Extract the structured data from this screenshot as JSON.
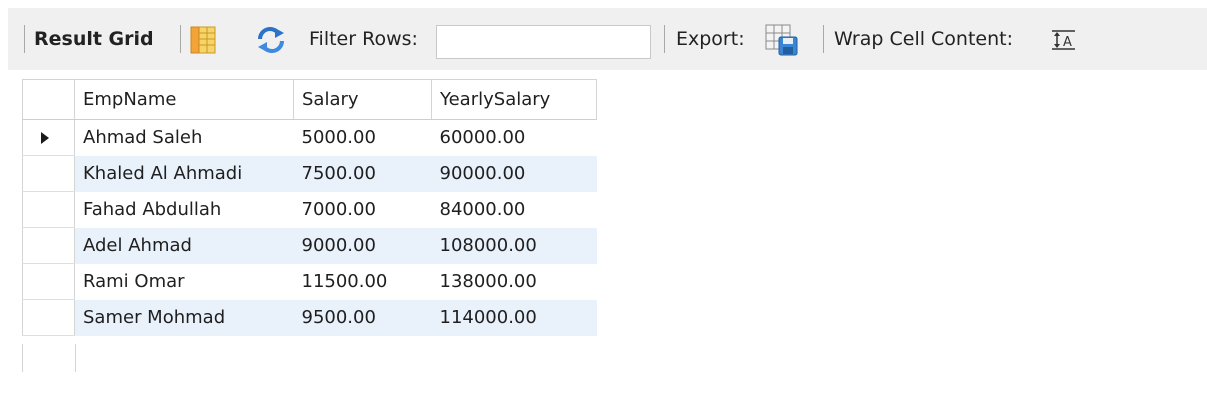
{
  "toolbar": {
    "result_grid_label": "Result Grid",
    "filter_rows_label": "Filter Rows:",
    "filter_value": "",
    "export_label": "Export:",
    "wrap_label": "Wrap Cell Content:",
    "icons": [
      "form-editor-icon",
      "refresh-icon",
      "export-icon",
      "wrap-cell-icon"
    ]
  },
  "grid": {
    "columns": [
      "EmpName",
      "Salary",
      "YearlySalary"
    ],
    "rows": [
      [
        "Ahmad Saleh",
        "5000.00",
        "60000.00"
      ],
      [
        "Khaled Al Ahmadi",
        "7500.00",
        "90000.00"
      ],
      [
        "Fahad Abdullah",
        "7000.00",
        "84000.00"
      ],
      [
        "Adel Ahmad",
        "9000.00",
        "108000.00"
      ],
      [
        "Rami Omar",
        "11500.00",
        "138000.00"
      ],
      [
        "Samer Mohmad",
        "9500.00",
        "114000.00"
      ]
    ],
    "selected_row": 0,
    "alt_row_color": "#e9f1fb"
  }
}
